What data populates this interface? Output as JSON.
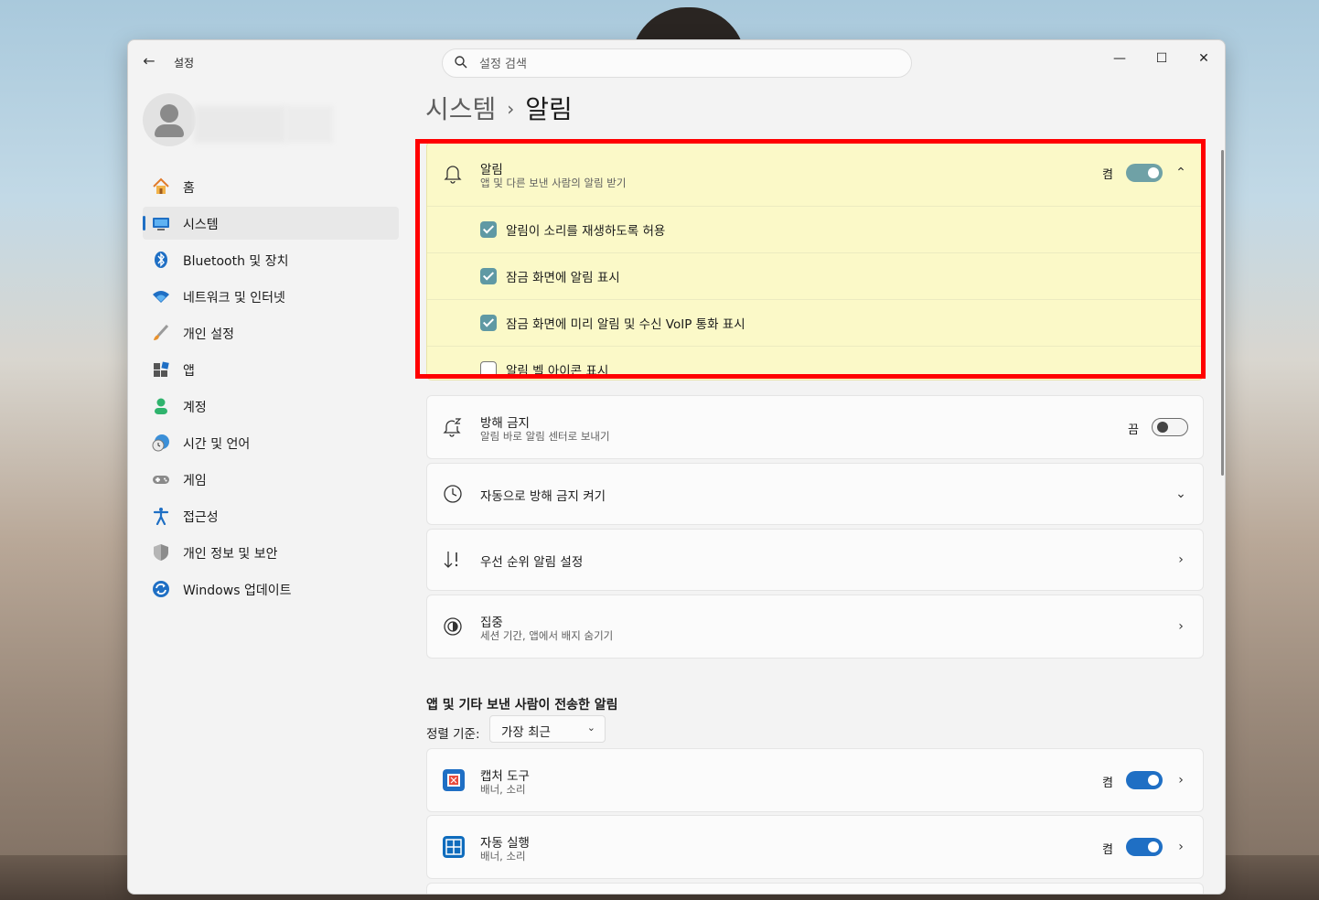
{
  "window": {
    "app_title": "설정",
    "search_placeholder": "설정 검색",
    "controls": {
      "minimize": "—",
      "maximize": "☐",
      "close": "✕"
    }
  },
  "sidebar": {
    "items": [
      {
        "label": "홈",
        "icon": "home-icon"
      },
      {
        "label": "시스템",
        "icon": "system-icon",
        "active": true
      },
      {
        "label": "Bluetooth 및 장치",
        "icon": "bluetooth-icon"
      },
      {
        "label": "네트워크 및 인터넷",
        "icon": "wifi-icon"
      },
      {
        "label": "개인 설정",
        "icon": "brush-icon"
      },
      {
        "label": "앱",
        "icon": "apps-icon"
      },
      {
        "label": "계정",
        "icon": "account-icon"
      },
      {
        "label": "시간 및 언어",
        "icon": "globe-clock-icon"
      },
      {
        "label": "게임",
        "icon": "gamepad-icon"
      },
      {
        "label": "접근성",
        "icon": "accessibility-icon"
      },
      {
        "label": "개인 정보 및 보안",
        "icon": "shield-icon"
      },
      {
        "label": "Windows 업데이트",
        "icon": "update-icon"
      }
    ]
  },
  "breadcrumb": {
    "parent": "시스템",
    "separator": "›",
    "current": "알림"
  },
  "notifications": {
    "title": "알림",
    "subtitle": "앱 및 다른 보낸 사람의 알림 받기",
    "state_label": "켬",
    "enabled": true,
    "options": [
      {
        "label": "알림이 소리를 재생하도록 허용",
        "checked": true
      },
      {
        "label": "잠금 화면에 알림 표시",
        "checked": true
      },
      {
        "label": "잠금 화면에 미리 알림 및 수신 VoIP 통화 표시",
        "checked": true
      },
      {
        "label": "알림 벨 아이콘 표시",
        "checked": false
      }
    ]
  },
  "dnd": {
    "title": "방해 금지",
    "subtitle": "알림 바로 알림 센터로 보내기",
    "state_label": "끔",
    "enabled": false
  },
  "auto_dnd": {
    "title": "자동으로 방해 금지 켜기"
  },
  "priority": {
    "title": "우선 순위 알림 설정"
  },
  "focus": {
    "title": "집중",
    "subtitle": "세션 기간, 앱에서 배지 숨기기"
  },
  "app_section": {
    "header": "앱 및 기타 보낸 사람이 전송한 알림",
    "sort_label": "정렬 기준:",
    "sort_value": "가장 최근",
    "apps": [
      {
        "name": "캡처 도구",
        "detail": "배너, 소리",
        "state_label": "켬",
        "enabled": true,
        "color": "#1f6fc4"
      },
      {
        "name": "자동 실행",
        "detail": "배너, 소리",
        "state_label": "켬",
        "enabled": true,
        "color": "#0f6cbd"
      }
    ]
  },
  "colors": {
    "accent": "#1f6fc4",
    "highlight_border": "#ff0000",
    "highlight_fill": "#fbf9c8"
  }
}
